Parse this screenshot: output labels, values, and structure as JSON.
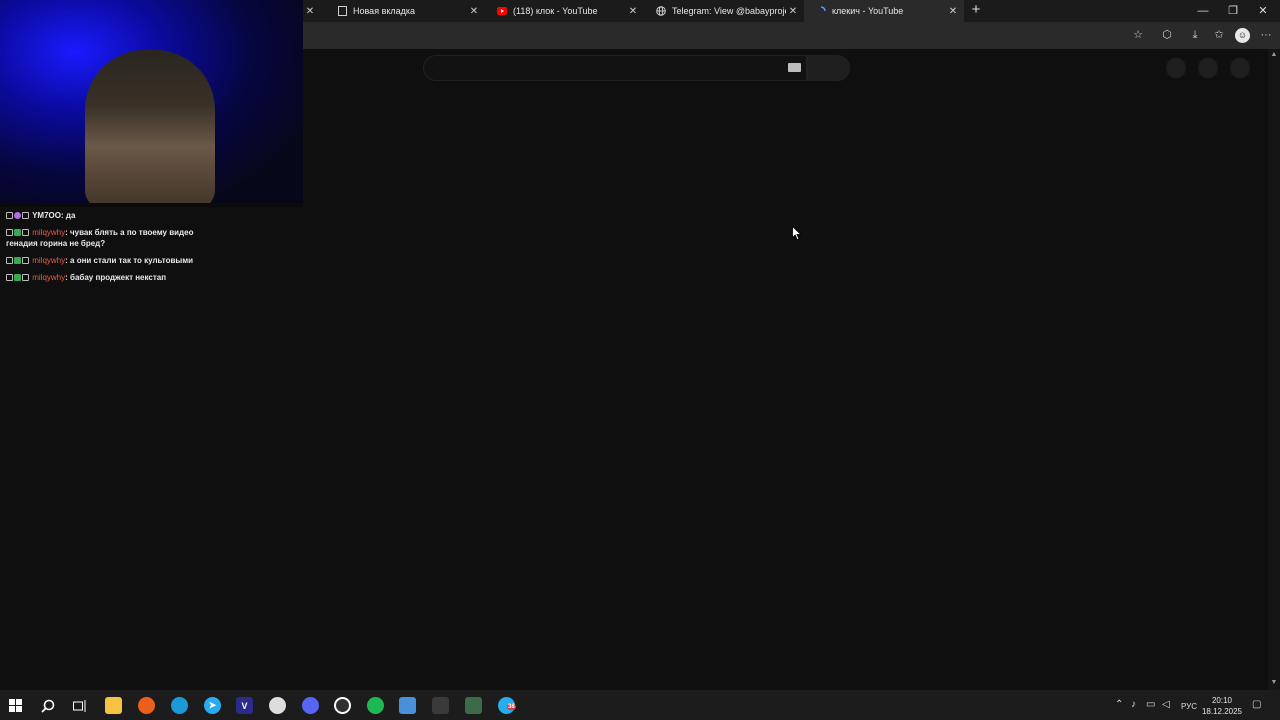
{
  "browser": {
    "tabs": [
      {
        "title": "Новая вкладка",
        "icon": "blank-page-icon",
        "active": false
      },
      {
        "title": "(118) клок - YouTube",
        "icon": "youtube-icon",
        "active": false
      },
      {
        "title": "Telegram: View @babayproject",
        "icon": "globe-icon",
        "active": false
      },
      {
        "title": "клекич - YouTube",
        "icon": "loading-icon",
        "active": true
      }
    ],
    "close_glyph": "✕",
    "new_tab_glyph": "+",
    "window_controls": {
      "minimize": "—",
      "restore": "❐",
      "close": "✕"
    }
  },
  "toolbar": {
    "icons": [
      "favorite-star-icon",
      "extensions-icon",
      "downloads-icon",
      "collections-icon",
      "profile-icon",
      "menu-icon"
    ],
    "menu_glyph": "···"
  },
  "chat": {
    "messages": [
      {
        "user": "YM7OO",
        "text": ": да",
        "user_highlight": false
      },
      {
        "user": "milqywhy",
        "text": ": чувак блять а по твоему видео генадия горина не бред?",
        "user_highlight": true
      },
      {
        "user": "milqywhy",
        "text": ": а они стали так то культовыми",
        "user_highlight": true
      },
      {
        "user": "milqywhy",
        "text": ": бабау проджект некстап",
        "user_highlight": true
      }
    ]
  },
  "taskbar": {
    "apps": [
      "windows-start-icon",
      "search-icon",
      "task-view-icon",
      "file-explorer-icon",
      "firefox-icon",
      "edge-icon",
      "telegram-icon",
      "vegas-icon",
      "chrome-icon",
      "discord-icon",
      "obs-icon",
      "spotify-icon",
      "remote-desktop-icon",
      "notepad-icon",
      "hardware-monitor-icon",
      "app-notification-icon"
    ],
    "notification_badge": "38",
    "lang": "РУС",
    "time": "20:10",
    "date": "18.12.2025"
  },
  "colors": {
    "page_bg": "#0f0f0f",
    "chat_username": "#e95b43",
    "youtube_red": "#ff0000",
    "spotify_green": "#1db954",
    "telegram_blue": "#2aabee",
    "discord_blurple": "#5865f2"
  }
}
